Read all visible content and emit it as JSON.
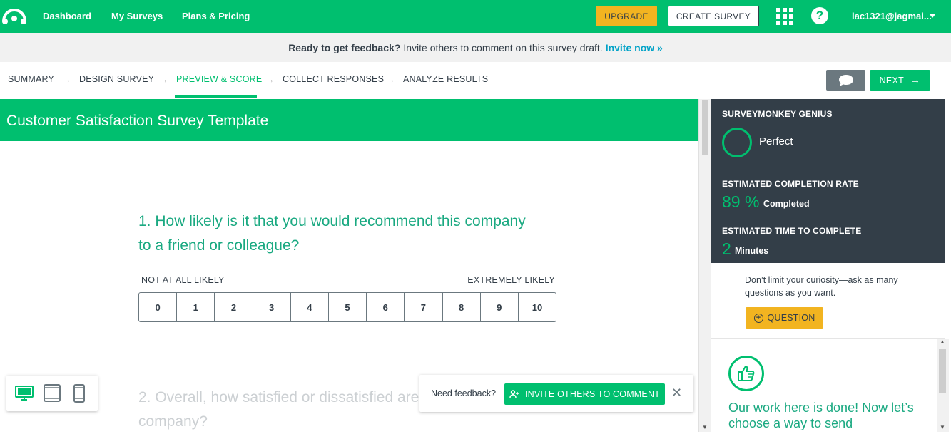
{
  "topbar": {
    "nav": [
      "Dashboard",
      "My Surveys",
      "Plans & Pricing"
    ],
    "upgrade_label": "UPGRADE",
    "create_label": "CREATE SURVEY",
    "help_glyph": "?",
    "user": "lac1321@jagmai..."
  },
  "banner": {
    "bold": "Ready to get feedback?",
    "text": "Invite others to comment on this survey draft.",
    "link": "Invite now »"
  },
  "steps": {
    "items": [
      "SUMMARY",
      "DESIGN SURVEY",
      "PREVIEW & SCORE",
      "COLLECT RESPONSES",
      "ANALYZE RESULTS"
    ],
    "active_index": 2,
    "next_label": "NEXT"
  },
  "survey": {
    "title": "Customer Satisfaction Survey Template",
    "q1": "1. How likely is it that you would recommend this company to a friend or colleague?",
    "scale_low": "NOT AT ALL LIKELY",
    "scale_high": "EXTREMELY LIKELY",
    "scale": [
      "0",
      "1",
      "2",
      "3",
      "4",
      "5",
      "6",
      "7",
      "8",
      "9",
      "10"
    ],
    "q2": "2. Overall, how satisfied or dissatisfied are you with our company?"
  },
  "feedback_popup": {
    "text": "Need feedback?",
    "invite_label": "INVITE OTHERS TO COMMENT",
    "close_glyph": "✕"
  },
  "genius": {
    "title": "SURVEYMONKEY GENIUS",
    "rating": "Perfect",
    "completion_heading": "ESTIMATED COMPLETION RATE",
    "completion_value": "89 %",
    "completion_unit": "Completed",
    "time_heading": "ESTIMATED TIME TO COMPLETE",
    "time_value": "2",
    "time_unit": "Minutes"
  },
  "curiosity": {
    "text": "Don’t limit your curiosity—ask as many questions as you want.",
    "question_label": "QUESTION"
  },
  "done": {
    "text": "Our work here is done! Now let’s choose a way to send"
  },
  "colors": {
    "brand_green": "#00bf6f",
    "dark_panel": "#333e48",
    "accent_yellow": "#f2b420",
    "link_blue": "#00a2c7"
  }
}
